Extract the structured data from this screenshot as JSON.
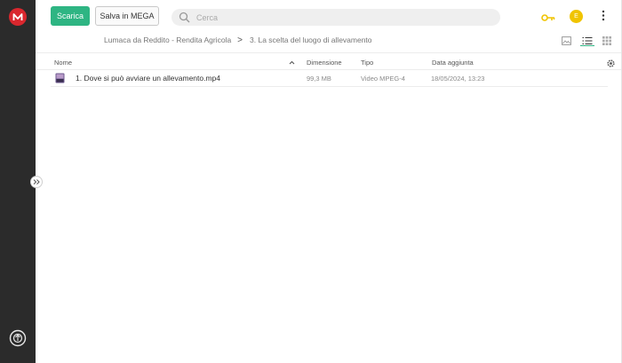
{
  "topbar": {
    "download_label": "Scarica",
    "save_label": "Salva in MEGA",
    "search_placeholder": "Cerca",
    "avatar_initial": "E",
    "icons": [
      "search-icon",
      "key-icon",
      "more-vertical-icon"
    ]
  },
  "breadcrumb": {
    "items": [
      "Lumaca da Reddito - Rendita Agricola",
      "3. La scelta del luogo di allevamento"
    ],
    "separator": ">"
  },
  "table": {
    "columns": [
      "Nome",
      "Dimensione",
      "Tipo",
      "Data aggiunta"
    ],
    "rows": [
      {
        "name": "1. Dove si può avviare un allevamento.mp4",
        "size": "99,3 MB",
        "type": "Video MPEG-4",
        "date": "18/05/2024, 13:23"
      }
    ]
  },
  "colors": {
    "accent": "#2eb583",
    "rail": "#2b2b2b",
    "logo": "#d9272e",
    "avatar": "#f0c400",
    "key": "#f0c400"
  }
}
